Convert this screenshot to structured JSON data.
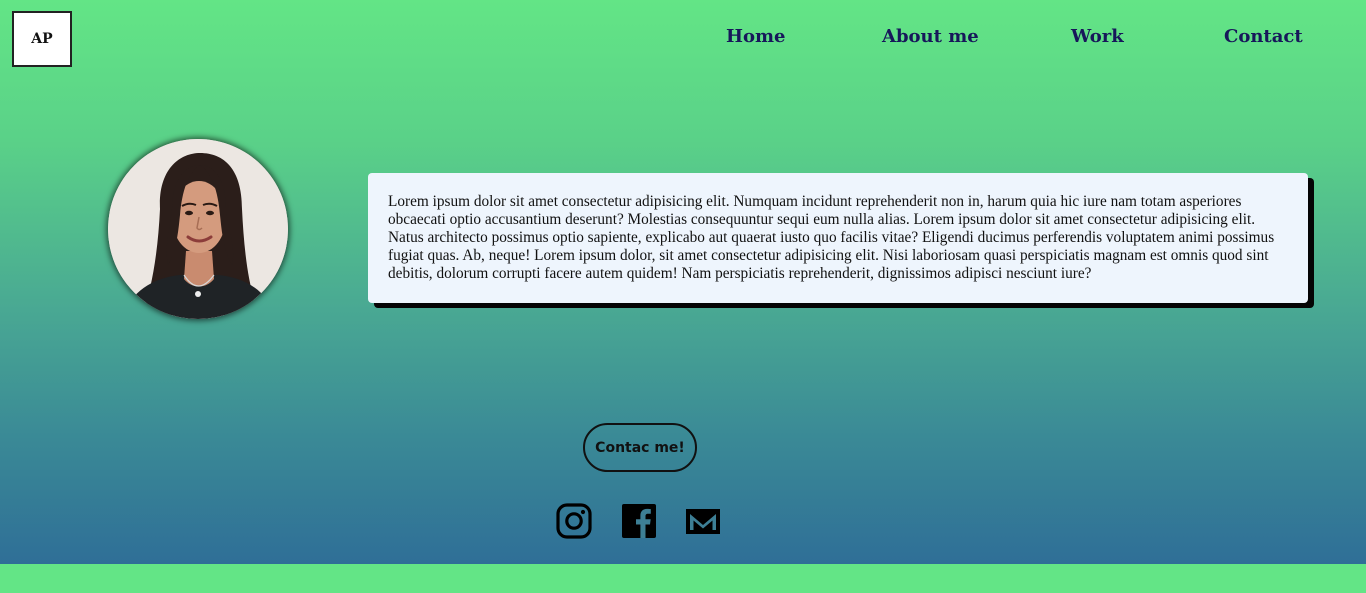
{
  "logo": {
    "text": "AP"
  },
  "nav": {
    "items": [
      {
        "label": "Home"
      },
      {
        "label": "About me"
      },
      {
        "label": "Work"
      },
      {
        "label": "Contact"
      }
    ]
  },
  "bio": {
    "text": "Lorem ipsum dolor sit amet consectetur adipisicing elit. Numquam incidunt reprehenderit non in, harum quia hic iure nam totam asperiores obcaecati optio accusantium deserunt? Molestias consequuntur sequi eum nulla alias. Lorem ipsum dolor sit amet consectetur adipisicing elit. Natus architecto possimus optio sapiente, explicabo aut quaerat iusto quo facilis vitae? Eligendi ducimus perferendis voluptatem animi possimus fugiat quas. Ab, neque! Lorem ipsum dolor, sit amet consectetur adipisicing elit. Nisi laboriosam quasi perspiciatis magnam est omnis quod sint debitis, dolorum corrupti facere autem quidem! Nam perspiciatis reprehenderit, dignissimos adipisci nesciunt iure?"
  },
  "cta": {
    "label": "Contac me!"
  },
  "social": {
    "icons": [
      "instagram-icon",
      "facebook-icon",
      "email-icon"
    ]
  },
  "colors": {
    "gradient_top": "#63e586",
    "gradient_bottom": "#2f6f97",
    "nav_text": "#17175a",
    "card_background": "#eef5fd",
    "footer_strip": "#63e586"
  }
}
